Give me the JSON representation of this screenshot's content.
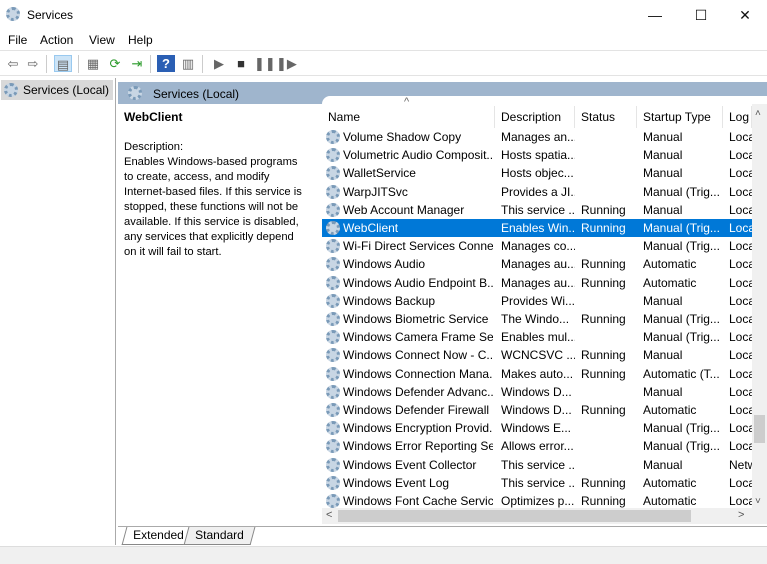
{
  "window": {
    "title": "Services",
    "minimize": "—",
    "maximize": "☐",
    "close": "✕"
  },
  "menu": [
    "File",
    "Action",
    "View",
    "Help"
  ],
  "toolbar": [
    {
      "icon": "back-icon",
      "glyph": "⇦"
    },
    {
      "icon": "forward-icon",
      "glyph": "⇨"
    },
    {
      "icon": "show-hide-tree-icon",
      "glyph": "▤"
    },
    {
      "icon": "properties-icon",
      "glyph": "▦"
    },
    {
      "icon": "refresh-icon",
      "glyph": "⟳"
    },
    {
      "icon": "export-list-icon",
      "glyph": "⇥"
    },
    {
      "icon": "help-icon",
      "glyph": "?"
    },
    {
      "icon": "show-action-pane-icon",
      "glyph": "▥"
    },
    {
      "icon": "start-service-icon",
      "glyph": "▶"
    },
    {
      "icon": "stop-service-icon",
      "glyph": "■"
    },
    {
      "icon": "pause-service-icon",
      "glyph": "❚❚"
    },
    {
      "icon": "restart-service-icon",
      "glyph": "❚▶"
    }
  ],
  "tree": {
    "item": "Services (Local)"
  },
  "pane": {
    "header": "Services (Local)",
    "service_name": "WebClient",
    "description_label": "Description:",
    "description": "Enables Windows-based programs to create, access, and modify Internet-based files. If this service is stopped, these functions will not be available. If this service is disabled, any services that explicitly depend on it will fail to start."
  },
  "columns": [
    "Name",
    "Description",
    "Status",
    "Startup Type",
    "Log"
  ],
  "sort_indicator": "^",
  "rows": [
    [
      "Volume Shadow Copy",
      "Manages an...",
      "",
      "Manual",
      "Loca"
    ],
    [
      "Volumetric Audio Composit...",
      "Hosts spatia...",
      "",
      "Manual",
      "Loca"
    ],
    [
      "WalletService",
      "Hosts objec...",
      "",
      "Manual",
      "Loca"
    ],
    [
      "WarpJITSvc",
      "Provides a JI...",
      "",
      "Manual (Trig...",
      "Loca"
    ],
    [
      "Web Account Manager",
      "This service ...",
      "Running",
      "Manual",
      "Loca"
    ],
    [
      "WebClient",
      "Enables Win...",
      "Running",
      "Manual (Trig...",
      "Loca"
    ],
    [
      "Wi-Fi Direct Services Conne...",
      "Manages co...",
      "",
      "Manual (Trig...",
      "Loca"
    ],
    [
      "Windows Audio",
      "Manages au...",
      "Running",
      "Automatic",
      "Loca"
    ],
    [
      "Windows Audio Endpoint B...",
      "Manages au...",
      "Running",
      "Automatic",
      "Loca"
    ],
    [
      "Windows Backup",
      "Provides Wi...",
      "",
      "Manual",
      "Loca"
    ],
    [
      "Windows Biometric Service",
      "The Windo...",
      "Running",
      "Manual (Trig...",
      "Loca"
    ],
    [
      "Windows Camera Frame Se...",
      "Enables mul...",
      "",
      "Manual (Trig...",
      "Loca"
    ],
    [
      "Windows Connect Now - C...",
      "WCNCSVC ...",
      "Running",
      "Manual",
      "Loca"
    ],
    [
      "Windows Connection Mana...",
      "Makes auto...",
      "Running",
      "Automatic (T...",
      "Loca"
    ],
    [
      "Windows Defender Advanc...",
      "Windows D...",
      "",
      "Manual",
      "Loca"
    ],
    [
      "Windows Defender Firewall",
      "Windows D...",
      "Running",
      "Automatic",
      "Loca"
    ],
    [
      "Windows Encryption Provid...",
      "Windows E...",
      "",
      "Manual (Trig...",
      "Loca"
    ],
    [
      "Windows Error Reporting Se...",
      "Allows error...",
      "",
      "Manual (Trig...",
      "Loca"
    ],
    [
      "Windows Event Collector",
      "This service ...",
      "",
      "Manual",
      "Netw"
    ],
    [
      "Windows Event Log",
      "This service ...",
      "Running",
      "Automatic",
      "Loca"
    ],
    [
      "Windows Font Cache Service",
      "Optimizes p...",
      "Running",
      "Automatic",
      "Loca"
    ]
  ],
  "selected_row": 5,
  "scroll": {
    "up": "˄",
    "down": "˅",
    "left": "<",
    "right": ">"
  },
  "tabs": [
    "Extended",
    "Standard"
  ],
  "colors": {
    "selection": "#0078d7",
    "pane_header": "#9fb5cd"
  }
}
